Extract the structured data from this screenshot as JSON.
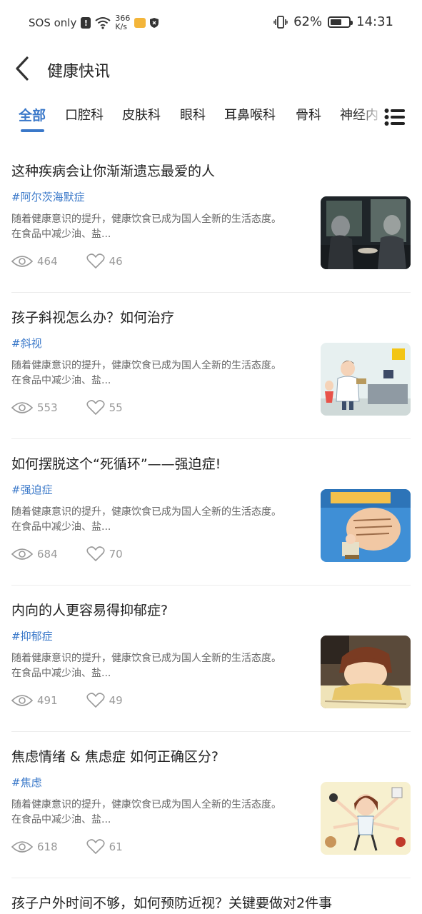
{
  "status_bar": {
    "carrier": "SOS only",
    "net_speed_value": "366",
    "net_speed_unit": "K/s",
    "battery": "62%",
    "battery_level": 0.62,
    "time": "14:31"
  },
  "header": {
    "title": "健康快讯"
  },
  "tabs": [
    {
      "label": "全部",
      "active": true
    },
    {
      "label": "口腔科",
      "active": false
    },
    {
      "label": "皮肤科",
      "active": false
    },
    {
      "label": "眼科",
      "active": false
    },
    {
      "label": "耳鼻喉科",
      "active": false
    },
    {
      "label": "骨科",
      "active": false
    },
    {
      "label": "神经内",
      "active": false
    }
  ],
  "articles": [
    {
      "title": "这种疾病会让你渐渐遗忘最爱的人",
      "tag": "#阿尔茨海默症",
      "summary_line1": "随着健康意识的提升，健康饮食已成为国人全新的生活态度。",
      "summary_line2": "在食品中减少油、盐...",
      "views": "464",
      "likes": "46",
      "image": "elderly-couple-photo"
    },
    {
      "title": "孩子斜视怎么办？如何治疗",
      "tag": "#斜视",
      "summary_line1": "随着健康意识的提升，健康饮食已成为国人全新的生活态度。",
      "summary_line2": "在食品中减少油、盐...",
      "views": "553",
      "likes": "55",
      "image": "doctor-clinic-illustration"
    },
    {
      "title": "如何摆脱这个“死循环”——强迫症!",
      "tag": "#强迫症",
      "summary_line1": "随着健康意识的提升，健康饮食已成为国人全新的生活态度。",
      "summary_line2": "在食品中减少油、盐...",
      "views": "684",
      "likes": "70",
      "image": "ocd-cartoon-illustration"
    },
    {
      "title": "内向的人更容易得抑郁症?",
      "tag": "#抑郁症",
      "summary_line1": "随着健康意识的提升，健康饮食已成为国人全新的生活态度。",
      "summary_line2": "在食品中减少油、盐...",
      "views": "491",
      "likes": "49",
      "image": "boy-studying-anime"
    },
    {
      "title": "焦虑情绪 & 焦虑症 如何正确区分?",
      "tag": "#焦虑",
      "summary_line1": "随着健康意识的提升，健康饮食已成为国人全新的生活态度。",
      "summary_line2": "在食品中减少油、盐...",
      "views": "618",
      "likes": "61",
      "image": "anxious-woman-illustration"
    }
  ],
  "partial_article": {
    "title": "孩子户外时间不够，如何预防近视？关键要做对2件事"
  },
  "colors": {
    "accent": "#3a78c9",
    "text_primary": "#222222",
    "text_secondary": "#666666",
    "text_muted": "#999999"
  }
}
